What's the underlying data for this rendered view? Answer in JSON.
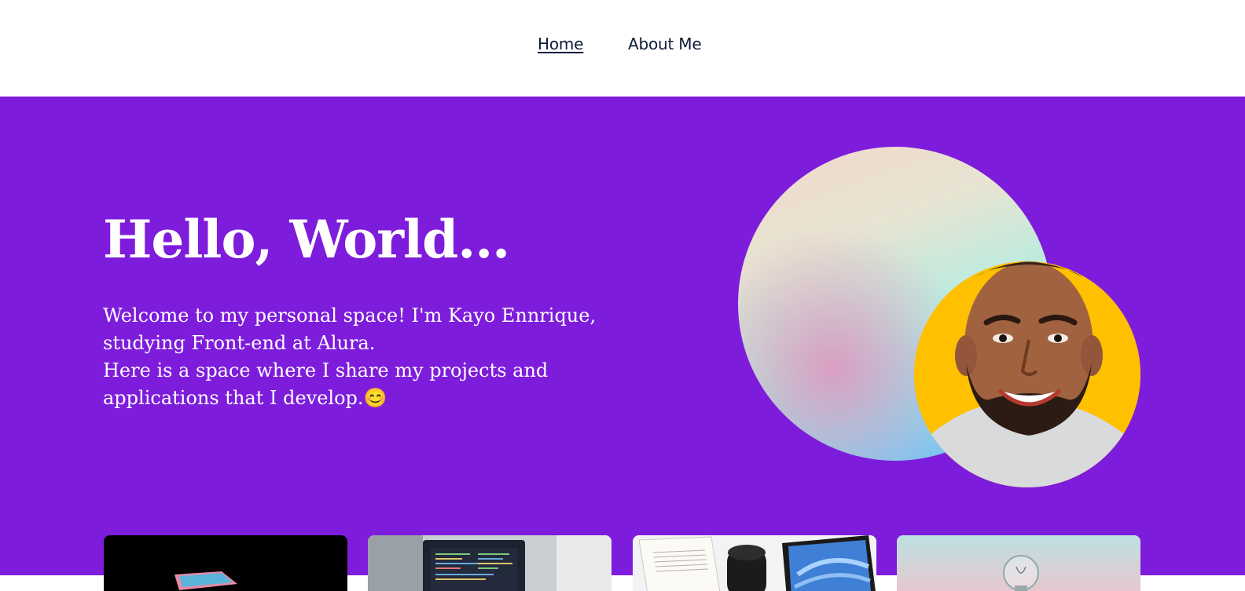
{
  "nav": {
    "items": [
      {
        "label": "Home",
        "active": true
      },
      {
        "label": "About Me",
        "active": false
      }
    ]
  },
  "hero": {
    "title": "Hello, World...",
    "paragraphs": [
      "Welcome to my personal space! I'm Kayo Ennrique, studying Front-end at Alura.",
      "Here is a space where I share my projects and applications that I develop.😊"
    ],
    "background_color": "#7e1cdc",
    "avatar_background": "#ffc000"
  },
  "projects": [
    {
      "icon": "laptop-image"
    },
    {
      "icon": "code-editor-image"
    },
    {
      "icon": "book-camera-tablet-image"
    },
    {
      "icon": "lightbulb-image"
    }
  ]
}
